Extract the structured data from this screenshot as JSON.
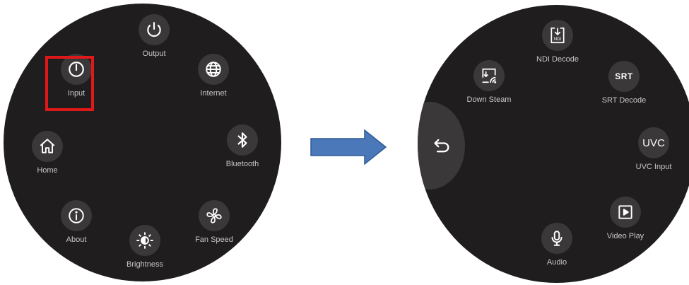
{
  "left_dial": {
    "items": [
      {
        "label": "Output",
        "icon": "power-icon"
      },
      {
        "label": "Input",
        "icon": "power-icon"
      },
      {
        "label": "Internet",
        "icon": "globe-icon"
      },
      {
        "label": "Home",
        "icon": "home-icon"
      },
      {
        "label": "Bluetooth",
        "icon": "bluetooth-icon"
      },
      {
        "label": "About",
        "icon": "info-icon"
      },
      {
        "label": "Fan Speed",
        "icon": "fan-icon"
      },
      {
        "label": "Brightness",
        "icon": "brightness-icon"
      }
    ],
    "selected": "Input"
  },
  "transition_arrow": {
    "color": "#4a78b8",
    "icon": "right-arrow-icon"
  },
  "right_dial": {
    "back_icon": "back-icon",
    "items": [
      {
        "label": "NDI Decode",
        "icon": "ndi-icon",
        "icon_text": "NDI"
      },
      {
        "label": "Down Steam",
        "icon": "cast-icon"
      },
      {
        "label": "SRT Decode",
        "icon": "srt-icon",
        "icon_text": "SRT"
      },
      {
        "label": "UVC Input",
        "icon": "uvc-icon",
        "icon_text": "UVC"
      },
      {
        "label": "Video Play",
        "icon": "play-icon"
      },
      {
        "label": "Audio",
        "icon": "microphone-icon"
      }
    ]
  },
  "colors": {
    "dial_bg": "#1f1d1e",
    "button_bg": "#3a3839",
    "label": "#c8c8c8",
    "highlight": "#e01818"
  }
}
